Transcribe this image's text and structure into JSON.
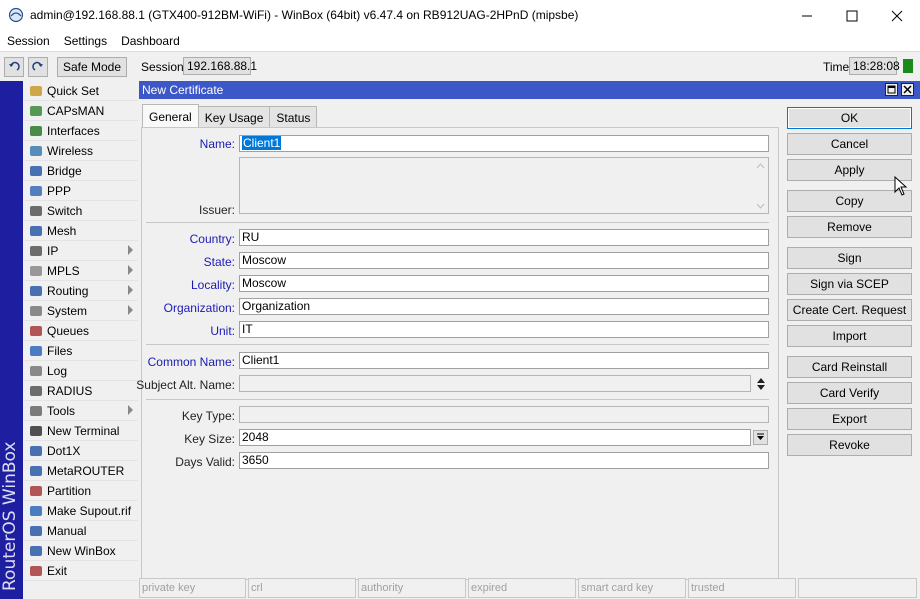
{
  "window": {
    "title": "admin@192.168.88.1 (GTX400-912BM-WiFi) - WinBox (64bit) v6.47.4 on RB912UAG-2HPnD (mipsbe)"
  },
  "menubar": [
    "Session",
    "Settings",
    "Dashboard"
  ],
  "toolbar": {
    "safe_mode": "Safe Mode",
    "session_label": "Session:",
    "session_value": "192.168.88.1",
    "time_label": "Time:",
    "time_value": "18:28:08"
  },
  "brand": "RouterOS WinBox",
  "sidebar": {
    "items": [
      {
        "label": "Quick Set",
        "icon": "quick-set-icon",
        "submenu": false
      },
      {
        "label": "CAPsMAN",
        "icon": "capsman-icon",
        "submenu": false
      },
      {
        "label": "Interfaces",
        "icon": "interfaces-icon",
        "submenu": false
      },
      {
        "label": "Wireless",
        "icon": "wireless-icon",
        "submenu": false
      },
      {
        "label": "Bridge",
        "icon": "bridge-icon",
        "submenu": false
      },
      {
        "label": "PPP",
        "icon": "ppp-icon",
        "submenu": false
      },
      {
        "label": "Switch",
        "icon": "switch-icon",
        "submenu": false
      },
      {
        "label": "Mesh",
        "icon": "mesh-icon",
        "submenu": false
      },
      {
        "label": "IP",
        "icon": "ip-icon",
        "submenu": true
      },
      {
        "label": "MPLS",
        "icon": "mpls-icon",
        "submenu": true
      },
      {
        "label": "Routing",
        "icon": "routing-icon",
        "submenu": true
      },
      {
        "label": "System",
        "icon": "system-icon",
        "submenu": true
      },
      {
        "label": "Queues",
        "icon": "queues-icon",
        "submenu": false
      },
      {
        "label": "Files",
        "icon": "files-icon",
        "submenu": false
      },
      {
        "label": "Log",
        "icon": "log-icon",
        "submenu": false
      },
      {
        "label": "RADIUS",
        "icon": "radius-icon",
        "submenu": false
      },
      {
        "label": "Tools",
        "icon": "tools-icon",
        "submenu": true
      },
      {
        "label": "New Terminal",
        "icon": "terminal-icon",
        "submenu": false
      },
      {
        "label": "Dot1X",
        "icon": "dot1x-icon",
        "submenu": false
      },
      {
        "label": "MetaROUTER",
        "icon": "metarouter-icon",
        "submenu": false
      },
      {
        "label": "Partition",
        "icon": "partition-icon",
        "submenu": false
      },
      {
        "label": "Make Supout.rif",
        "icon": "supout-icon",
        "submenu": false
      },
      {
        "label": "Manual",
        "icon": "manual-icon",
        "submenu": false
      },
      {
        "label": "New WinBox",
        "icon": "new-winbox-icon",
        "submenu": false
      },
      {
        "label": "Exit",
        "icon": "exit-icon",
        "submenu": false
      }
    ]
  },
  "dialog": {
    "title": "New Certificate",
    "tabs": [
      "General",
      "Key Usage",
      "Status"
    ],
    "fields": {
      "name": {
        "label": "Name:",
        "value": "Client1"
      },
      "issuer": {
        "label": "Issuer:",
        "value": ""
      },
      "country": {
        "label": "Country:",
        "value": "RU"
      },
      "state": {
        "label": "State:",
        "value": "Moscow"
      },
      "locality": {
        "label": "Locality:",
        "value": "Moscow"
      },
      "organization": {
        "label": "Organization:",
        "value": "Organization"
      },
      "unit": {
        "label": "Unit:",
        "value": "IT"
      },
      "common_name": {
        "label": "Common Name:",
        "value": "Client1"
      },
      "subject_alt_name": {
        "label": "Subject Alt. Name:",
        "value": ""
      },
      "key_type": {
        "label": "Key Type:",
        "value": ""
      },
      "key_size": {
        "label": "Key Size:",
        "value": "2048"
      },
      "days_valid": {
        "label": "Days Valid:",
        "value": "3650"
      }
    },
    "buttons": [
      "OK",
      "Cancel",
      "Apply",
      "Copy",
      "Remove",
      "Sign",
      "Sign via SCEP",
      "Create Cert. Request",
      "Import",
      "Card Reinstall",
      "Card Verify",
      "Export",
      "Revoke"
    ],
    "status": [
      "private key",
      "crl",
      "authority",
      "expired",
      "smart card key",
      "trusted"
    ]
  },
  "colors": {
    "brand_bar": "#1e1ea0",
    "dialog_header": "#3c57c8",
    "field_label": "#1b1bb4",
    "status_indicator": "#1a8a1a"
  }
}
